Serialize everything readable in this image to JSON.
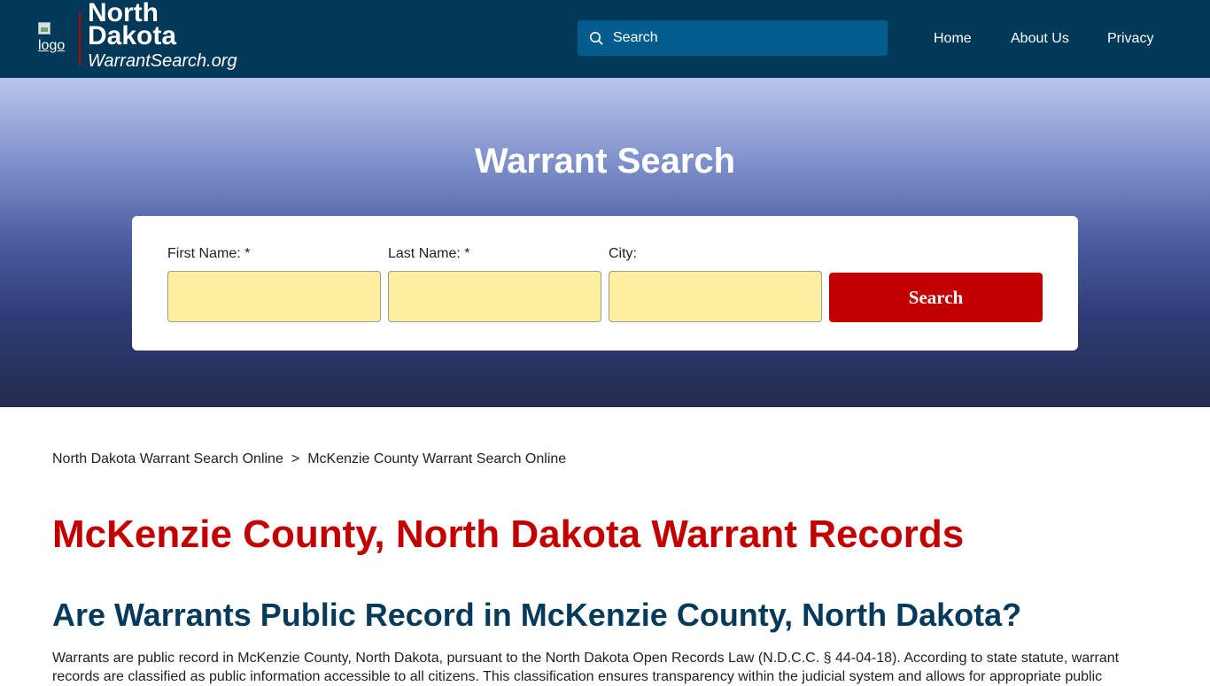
{
  "header": {
    "logo_alt": "logo",
    "brand_line1": "North",
    "brand_line2": "Dakota",
    "brand_sub": "WarrantSearch.org",
    "search_placeholder": "Search",
    "nav": {
      "home": "Home",
      "about": "About Us",
      "privacy": "Privacy"
    }
  },
  "hero": {
    "title": "Warrant Search",
    "form": {
      "first_name_label": "First Name:",
      "last_name_label": "Last Name:",
      "city_label": "City:",
      "required_marker": "*",
      "search_button": "Search"
    }
  },
  "breadcrumb": {
    "items": [
      "North Dakota Warrant Search Online",
      "McKenzie County Warrant Search Online"
    ],
    "separator": ">"
  },
  "content": {
    "page_title": "McKenzie County, North Dakota Warrant Records",
    "section_heading": "Are Warrants Public Record in McKenzie County, North Dakota?",
    "paragraph": "Warrants are public record in McKenzie County, North Dakota, pursuant to the North Dakota Open Records Law (N.D.C.C. § 44-04-18). According to state statute, warrant records are classified as public information accessible to all citizens. This classification ensures transparency within the judicial system and allows for appropriate public"
  },
  "colors": {
    "header_bg": "#023858",
    "search_bg": "#025c8e",
    "accent_red": "#c30000",
    "input_bg": "#feee9f",
    "heading_blue": "#053a5a"
  }
}
